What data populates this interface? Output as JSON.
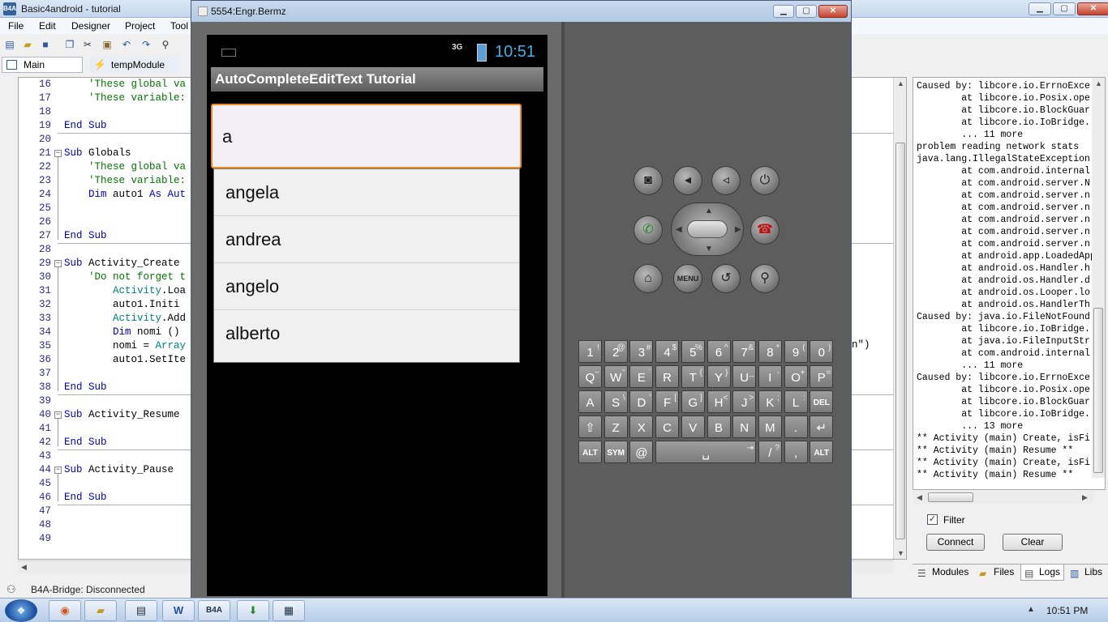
{
  "ide": {
    "title": "Basic4android - tutorial",
    "menu": [
      "File",
      "Edit",
      "Designer",
      "Project",
      "Tool"
    ],
    "tabs": [
      "Main",
      "tempModule"
    ],
    "status": "B4A-Bridge: Disconnected"
  },
  "code_lines": [
    {
      "n": "16",
      "segs": [
        {
          "cls": "c",
          "t": "    'These global va"
        }
      ]
    },
    {
      "n": "17",
      "segs": [
        {
          "cls": "c",
          "t": "    'These variable:"
        }
      ]
    },
    {
      "n": "18",
      "segs": []
    },
    {
      "n": "19",
      "segs": [
        {
          "cls": "k",
          "t": "End Sub"
        }
      ]
    },
    {
      "n": "20",
      "segs": []
    },
    {
      "n": "21",
      "fold": true,
      "segs": [
        {
          "cls": "k",
          "t": "Sub "
        },
        {
          "cls": "t",
          "t": "Globals"
        }
      ]
    },
    {
      "n": "22",
      "segs": [
        {
          "cls": "c",
          "t": "    'These global va"
        }
      ]
    },
    {
      "n": "23",
      "segs": [
        {
          "cls": "c",
          "t": "    'These variable:"
        }
      ]
    },
    {
      "n": "24",
      "segs": [
        {
          "cls": "k",
          "t": "    Dim "
        },
        {
          "cls": "t",
          "t": "auto1 "
        },
        {
          "cls": "k",
          "t": "As Aut"
        }
      ]
    },
    {
      "n": "25",
      "segs": []
    },
    {
      "n": "26",
      "segs": []
    },
    {
      "n": "27",
      "segs": [
        {
          "cls": "k",
          "t": "End Sub"
        }
      ]
    },
    {
      "n": "28",
      "segs": []
    },
    {
      "n": "29",
      "fold": true,
      "segs": [
        {
          "cls": "k",
          "t": "Sub "
        },
        {
          "cls": "t",
          "t": "Activity_Create"
        }
      ]
    },
    {
      "n": "30",
      "segs": [
        {
          "cls": "c",
          "t": "    'Do not forget t"
        }
      ]
    },
    {
      "n": "31",
      "segs": [
        {
          "cls": "o",
          "t": "        Activity"
        },
        {
          "cls": "t",
          "t": ".Loa"
        }
      ]
    },
    {
      "n": "32",
      "segs": [
        {
          "cls": "t",
          "t": "        auto1.Initi"
        }
      ]
    },
    {
      "n": "33",
      "segs": [
        {
          "cls": "o",
          "t": "        Activity"
        },
        {
          "cls": "t",
          "t": ".Add"
        }
      ]
    },
    {
      "n": "34",
      "segs": [
        {
          "cls": "k",
          "t": "        Dim "
        },
        {
          "cls": "t",
          "t": "nomi ()"
        }
      ]
    },
    {
      "n": "35",
      "segs": [
        {
          "cls": "t",
          "t": "        nomi = "
        },
        {
          "cls": "o",
          "t": "Array"
        }
      ]
    },
    {
      "n": "36",
      "segs": [
        {
          "cls": "t",
          "t": "        auto1.SetIte"
        }
      ]
    },
    {
      "n": "37",
      "segs": []
    },
    {
      "n": "38",
      "segs": [
        {
          "cls": "k",
          "t": "End Sub"
        }
      ]
    },
    {
      "n": "39",
      "segs": []
    },
    {
      "n": "40",
      "fold": true,
      "segs": [
        {
          "cls": "k",
          "t": "Sub "
        },
        {
          "cls": "t",
          "t": "Activity_Resume"
        }
      ]
    },
    {
      "n": "41",
      "segs": []
    },
    {
      "n": "42",
      "segs": [
        {
          "cls": "k",
          "t": "End Sub"
        }
      ]
    },
    {
      "n": "43",
      "segs": []
    },
    {
      "n": "44",
      "fold": true,
      "segs": [
        {
          "cls": "k",
          "t": "Sub "
        },
        {
          "cls": "t",
          "t": "Activity_Pause"
        }
      ]
    },
    {
      "n": "45",
      "segs": []
    },
    {
      "n": "46",
      "segs": [
        {
          "cls": "k",
          "t": "End Sub"
        }
      ]
    },
    {
      "n": "47",
      "segs": []
    },
    {
      "n": "48",
      "segs": []
    },
    {
      "n": "49",
      "segs": []
    }
  ],
  "code_tail": "n\")",
  "logs": [
    "Caused by: libcore.io.ErrnoExce",
    "        at libcore.io.Posix.ope",
    "        at libcore.io.BlockGuar",
    "        at libcore.io.IoBridge.",
    "        ... 11 more",
    "problem reading network stats",
    "java.lang.IllegalStateException",
    "        at com.android.internal",
    "        at com.android.server.N",
    "        at com.android.server.n",
    "        at com.android.server.n",
    "        at com.android.server.n",
    "        at com.android.server.n",
    "        at com.android.server.n",
    "        at android.app.LoadedApp",
    "        at android.os.Handler.h",
    "        at android.os.Handler.d",
    "        at android.os.Looper.lo",
    "        at android.os.HandlerTh",
    "Caused by: java.io.FileNotFound",
    "        at libcore.io.IoBridge.",
    "        at java.io.FileInputStr",
    "        at com.android.internal",
    "        ... 11 more",
    "Caused by: libcore.io.ErrnoExce",
    "        at libcore.io.Posix.ope",
    "        at libcore.io.BlockGuar",
    "        at libcore.io.IoBridge.",
    "        ... 13 more",
    "** Activity (main) Create, isFi",
    "** Activity (main) Resume **",
    "** Activity (main) Create, isFi",
    "** Activity (main) Resume **"
  ],
  "logs_panel": {
    "filter_label": "Filter",
    "filter_checked": "✓",
    "connect_label": "Connect",
    "clear_label": "Clear",
    "tabs": [
      "Modules",
      "Files",
      "Logs",
      "Libs"
    ]
  },
  "emulator": {
    "title": "5554:Engr.Bermz",
    "network": "3G",
    "time": "10:51",
    "app_title": "AutoCompleteEditText Tutorial",
    "input_value": "a",
    "suggestions": [
      "angela",
      "andrea",
      "angelo",
      "alberto"
    ],
    "menu_label": "MENU"
  },
  "keyboard_rows": [
    [
      [
        "1",
        "!"
      ],
      [
        "2",
        "@"
      ],
      [
        "3",
        "#"
      ],
      [
        "4",
        "$"
      ],
      [
        "5",
        "%"
      ],
      [
        "6",
        "^"
      ],
      [
        "7",
        "&"
      ],
      [
        "8",
        "*"
      ],
      [
        "9",
        "("
      ],
      [
        "0",
        ")"
      ]
    ],
    [
      [
        "Q",
        "~"
      ],
      [
        "W",
        "\""
      ],
      [
        "E",
        "`"
      ],
      [
        "R",
        ""
      ],
      [
        "T",
        "{"
      ],
      [
        "Y",
        "}"
      ],
      [
        "U",
        "_"
      ],
      [
        "I",
        "-"
      ],
      [
        "O",
        "+"
      ],
      [
        "P",
        "="
      ]
    ],
    [
      [
        "A",
        ""
      ],
      [
        "S",
        "\\"
      ],
      [
        "D",
        "'"
      ],
      [
        "F",
        "["
      ],
      [
        "G",
        "]"
      ],
      [
        "H",
        "<"
      ],
      [
        "J",
        ">"
      ],
      [
        "K",
        ";"
      ],
      [
        "L",
        ":"
      ],
      [
        "DEL",
        ""
      ]
    ],
    [
      [
        "⇧",
        ""
      ],
      [
        "Z",
        ""
      ],
      [
        "X",
        ""
      ],
      [
        "C",
        ""
      ],
      [
        "V",
        ""
      ],
      [
        "B",
        ""
      ],
      [
        "N",
        ""
      ],
      [
        "M",
        ""
      ],
      [
        ".",
        ""
      ],
      [
        "↵",
        ""
      ]
    ],
    [
      [
        "ALT",
        ""
      ],
      [
        "SYM",
        ""
      ],
      [
        "@",
        ""
      ],
      [
        "␣",
        "⇥"
      ],
      [
        "/",
        "?"
      ],
      [
        ",",
        ""
      ],
      [
        "ALT",
        ""
      ]
    ]
  ],
  "taskbar": {
    "clock": "10:51 PM",
    "items": [
      "firefox",
      "explorer",
      "notepad",
      "W",
      "B4A",
      "installer",
      "calculator"
    ]
  }
}
